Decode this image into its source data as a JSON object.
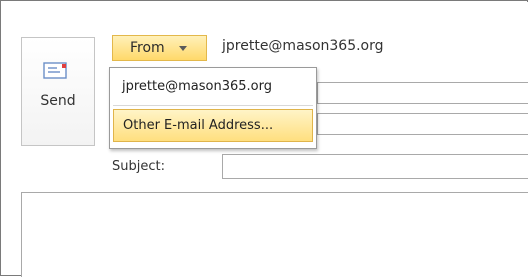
{
  "toolbar": {
    "send_label": "Send"
  },
  "from": {
    "button_label": "From",
    "value": "jprette@mason365.org"
  },
  "dropdown": {
    "items": [
      {
        "label": "jprette@mason365.org"
      },
      {
        "label": "Other E-mail Address..."
      }
    ]
  },
  "subject": {
    "label": "Subject:",
    "value": ""
  },
  "colors": {
    "highlight": "#ffd96a",
    "highlight_border": "#e3b84b",
    "border": "#a9a9a9"
  },
  "icons": {
    "send": "send-icon",
    "dropdown": "chevron-down-icon"
  }
}
